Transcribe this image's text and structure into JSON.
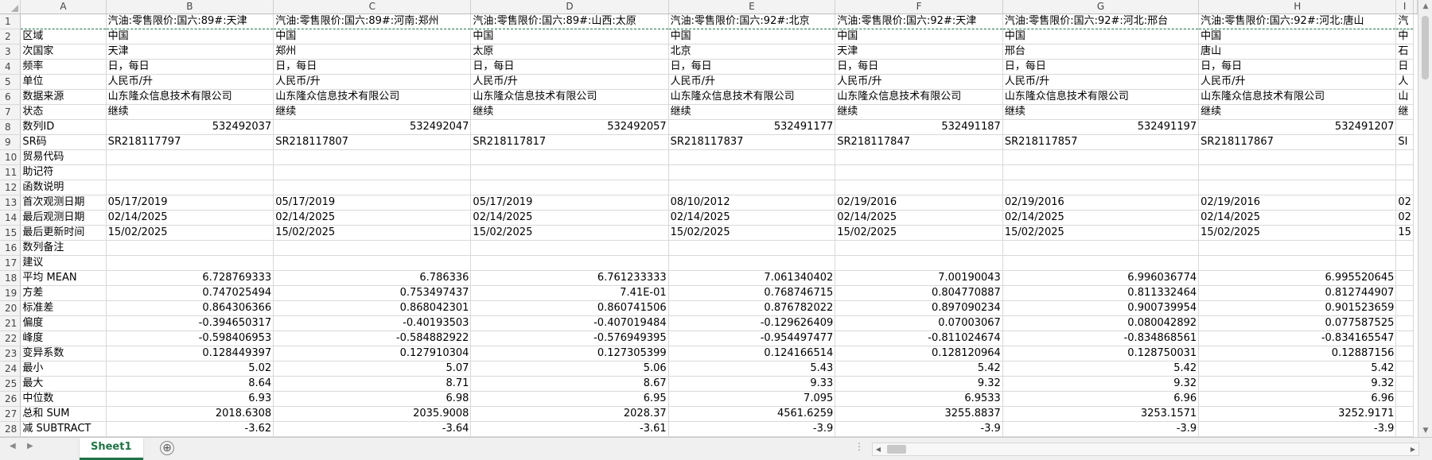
{
  "columns": [
    "A",
    "B",
    "C",
    "D",
    "E",
    "F",
    "G",
    "H",
    "I"
  ],
  "rows": [
    [
      "1",
      "",
      "汽油:零售限价:国六:89#:天津",
      "汽油:零售限价:国六:89#:河南:郑州",
      "汽油:零售限价:国六:89#:山西:太原",
      "汽油:零售限价:国六:92#:北京",
      "汽油:零售限价:国六:92#:天津",
      "汽油:零售限价:国六:92#:河北:邢台",
      "汽油:零售限价:国六:92#:河北:唐山",
      "汽"
    ],
    [
      "2",
      "区域",
      "中国",
      "中国",
      "中国",
      "中国",
      "中国",
      "中国",
      "中国",
      "中"
    ],
    [
      "3",
      "次国家",
      "天津",
      "郑州",
      "太原",
      "北京",
      "天津",
      "邢台",
      "唐山",
      "石"
    ],
    [
      "4",
      "频率",
      "日，每日",
      "日，每日",
      "日，每日",
      "日，每日",
      "日，每日",
      "日，每日",
      "日，每日",
      "日"
    ],
    [
      "5",
      "单位",
      "人民币/升",
      "人民币/升",
      "人民币/升",
      "人民币/升",
      "人民币/升",
      "人民币/升",
      "人民币/升",
      "人"
    ],
    [
      "6",
      "数据来源",
      "山东隆众信息技术有限公司",
      "山东隆众信息技术有限公司",
      "山东隆众信息技术有限公司",
      "山东隆众信息技术有限公司",
      "山东隆众信息技术有限公司",
      "山东隆众信息技术有限公司",
      "山东隆众信息技术有限公司",
      "山"
    ],
    [
      "7",
      "状态",
      "继续",
      "继续",
      "继续",
      "继续",
      "继续",
      "继续",
      "继续",
      "继"
    ],
    [
      "8",
      "数列ID",
      "532492037",
      "532492047",
      "532492057",
      "532491177",
      "532491187",
      "532491197",
      "532491207",
      ""
    ],
    [
      "9",
      "SR码",
      "SR218117797",
      "SR218117807",
      "SR218117817",
      "SR218117837",
      "SR218117847",
      "SR218117857",
      "SR218117867",
      "SI"
    ],
    [
      "10",
      "贸易代码",
      "",
      "",
      "",
      "",
      "",
      "",
      "",
      ""
    ],
    [
      "11",
      "助记符",
      "",
      "",
      "",
      "",
      "",
      "",
      "",
      ""
    ],
    [
      "12",
      "函数说明",
      "",
      "",
      "",
      "",
      "",
      "",
      "",
      ""
    ],
    [
      "13",
      "首次观测日期",
      "05/17/2019",
      "05/17/2019",
      "05/17/2019",
      "08/10/2012",
      "02/19/2016",
      "02/19/2016",
      "02/19/2016",
      "02"
    ],
    [
      "14",
      "最后观测日期",
      "02/14/2025",
      "02/14/2025",
      "02/14/2025",
      "02/14/2025",
      "02/14/2025",
      "02/14/2025",
      "02/14/2025",
      "02"
    ],
    [
      "15",
      "最后更新时间",
      "15/02/2025",
      "15/02/2025",
      "15/02/2025",
      "15/02/2025",
      "15/02/2025",
      "15/02/2025",
      "15/02/2025",
      "15"
    ],
    [
      "16",
      "数列备注",
      "",
      "",
      "",
      "",
      "",
      "",
      "",
      ""
    ],
    [
      "17",
      "建议",
      "",
      "",
      "",
      "",
      "",
      "",
      "",
      ""
    ],
    [
      "18",
      "平均 MEAN",
      "6.728769333",
      "6.786336",
      "6.761233333",
      "7.061340402",
      "7.00190043",
      "6.996036774",
      "6.995520645",
      ""
    ],
    [
      "19",
      "方差",
      "0.747025494",
      "0.753497437",
      "7.41E-01",
      "0.768746715",
      "0.804770887",
      "0.811332464",
      "0.812744907",
      ""
    ],
    [
      "20",
      "标准差",
      "0.864306366",
      "0.868042301",
      "0.860741506",
      "0.876782022",
      "0.897090234",
      "0.900739954",
      "0.901523659",
      ""
    ],
    [
      "21",
      "偏度",
      "-0.394650317",
      "-0.40193503",
      "-0.407019484",
      "-0.129626409",
      "0.07003067",
      "0.080042892",
      "0.077587525",
      ""
    ],
    [
      "22",
      "峰度",
      "-0.598406953",
      "-0.584882922",
      "-0.576949395",
      "-0.954497477",
      "-0.811024674",
      "-0.834868561",
      "-0.834165547",
      ""
    ],
    [
      "23",
      "变异系数",
      "0.128449397",
      "0.127910304",
      "0.127305399",
      "0.124166514",
      "0.128120964",
      "0.128750031",
      "0.12887156",
      ""
    ],
    [
      "24",
      "最小",
      "5.02",
      "5.07",
      "5.06",
      "5.43",
      "5.42",
      "5.42",
      "5.42",
      ""
    ],
    [
      "25",
      "最大",
      "8.64",
      "8.71",
      "8.67",
      "9.33",
      "9.32",
      "9.32",
      "9.32",
      ""
    ],
    [
      "26",
      "中位数",
      "6.93",
      "6.98",
      "6.95",
      "7.095",
      "6.9533",
      "6.96",
      "6.96",
      ""
    ],
    [
      "27",
      "总和 SUM",
      "2018.6308",
      "2035.9008",
      "2028.37",
      "4561.6259",
      "3255.8837",
      "3253.1571",
      "3252.9171",
      ""
    ],
    [
      "28",
      "减 SUBTRACT",
      "-3.62",
      "-3.64",
      "-3.61",
      "-3.9",
      "-3.9",
      "-3.9",
      "-3.9",
      ""
    ]
  ],
  "numeric_rows": [
    "8",
    "18",
    "19",
    "20",
    "21",
    "22",
    "23",
    "24",
    "25",
    "26",
    "27",
    "28"
  ],
  "sheet_tab": "Sheet1",
  "add_sheet": "⊕",
  "colors": {
    "accent": "#217346",
    "header_bg": "#f3f3f3",
    "grid": "#d9d9d9"
  }
}
